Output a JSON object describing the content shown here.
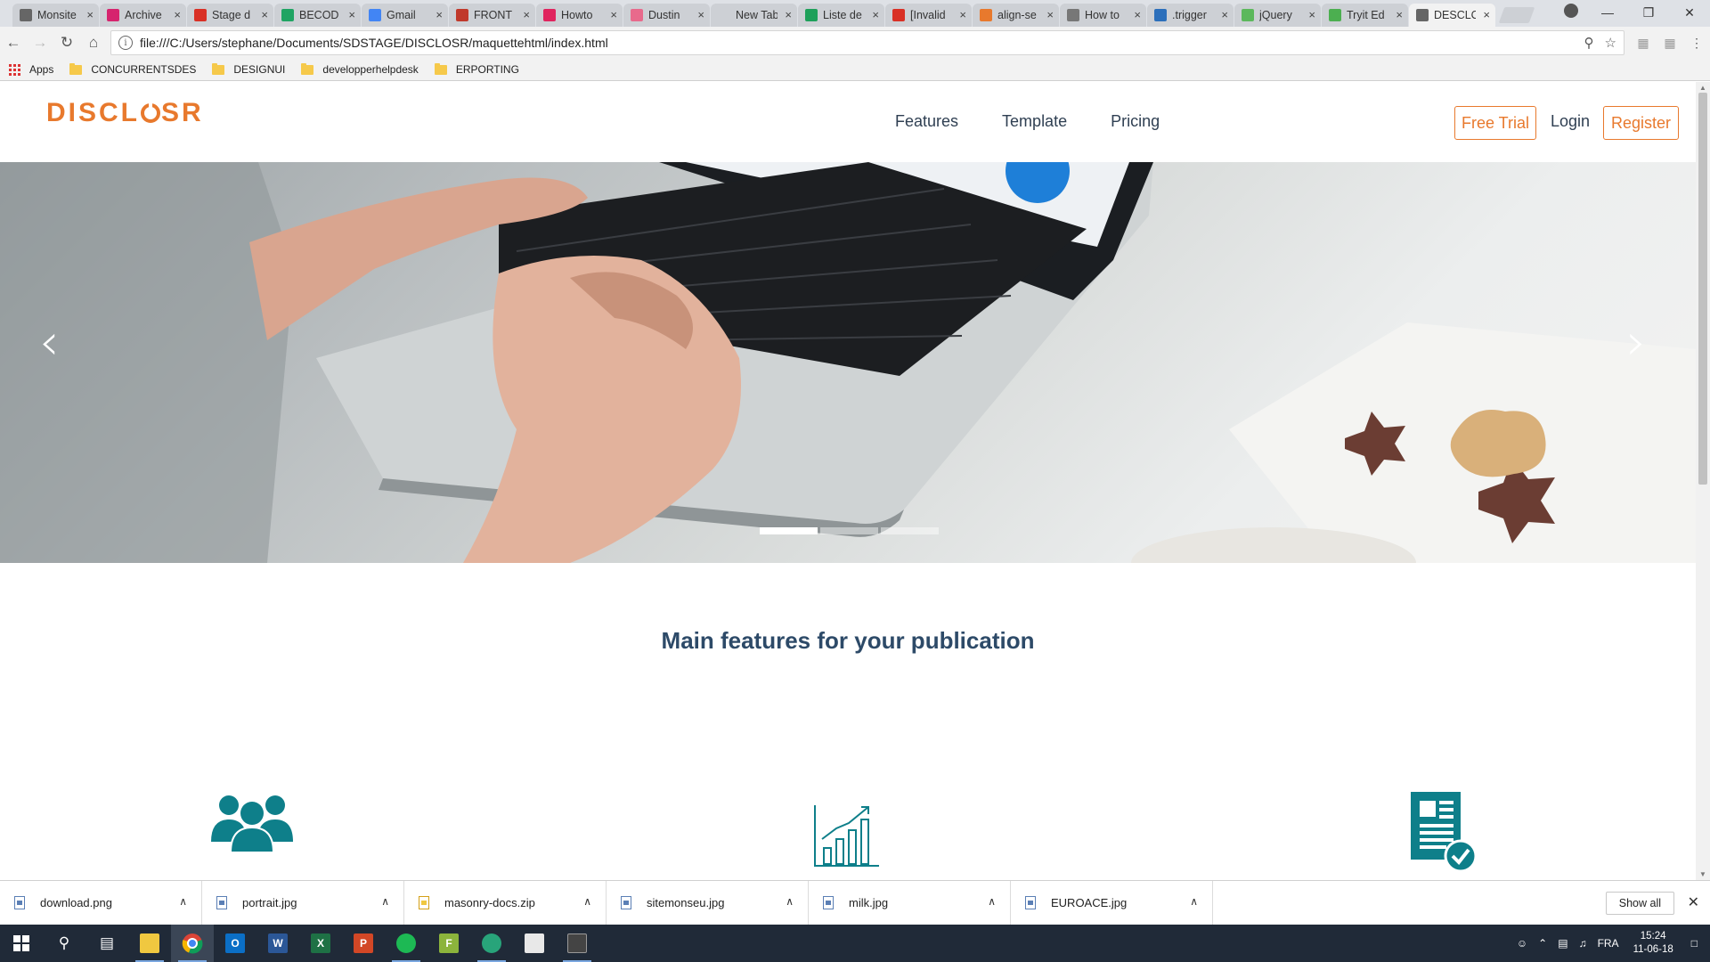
{
  "browser": {
    "tabs": [
      {
        "label": "Monsite",
        "favicon_color": "#666666",
        "active": false
      },
      {
        "label": "Archive",
        "favicon_color": "#d6246e",
        "active": false
      },
      {
        "label": "Stage d",
        "favicon_color": "#d93025",
        "active": false
      },
      {
        "label": "BECOD",
        "favicon_color": "#1fa463",
        "active": false
      },
      {
        "label": "Gmail",
        "favicon_color": "#4285f4",
        "active": false
      },
      {
        "label": "FRONT",
        "favicon_color": "#c0392b",
        "active": false
      },
      {
        "label": "Howto",
        "favicon_color": "#e0245e",
        "active": false
      },
      {
        "label": "Dustin",
        "favicon_color": "#e86a8c",
        "active": false
      },
      {
        "label": "New Tab",
        "favicon_color": "#cdd0d5",
        "active": false
      },
      {
        "label": "Liste de",
        "favicon_color": "#1ea05a",
        "active": false
      },
      {
        "label": "[Invalid",
        "favicon_color": "#d93025",
        "active": false
      },
      {
        "label": "align-se",
        "favicon_color": "#e8792d",
        "active": false
      },
      {
        "label": "How to",
        "favicon_color": "#777777",
        "active": false
      },
      {
        "label": ".trigger",
        "favicon_color": "#2c6fbb",
        "active": false
      },
      {
        "label": "jQuery",
        "favicon_color": "#5cb85c",
        "active": false
      },
      {
        "label": "Tryit Ed",
        "favicon_color": "#4caf50",
        "active": false
      },
      {
        "label": "DESCLC",
        "favicon_color": "#666666",
        "active": true
      }
    ],
    "address": "file:///C:/Users/stephane/Documents/SDSTAGE/DISCLOSR/maquettehtml/index.html",
    "bookmarks": [
      "Apps",
      "CONCURRENTSDES",
      "DESIGNUI",
      "developperhelpdesk",
      "ERPORTING"
    ]
  },
  "site": {
    "logo": "DISCL○SR",
    "logo_left": "DISCL",
    "logo_right": "SR",
    "nav": [
      "Features",
      "Template",
      "Pricing"
    ],
    "free_trial": "Free Trial",
    "login": "Login",
    "register": "Register",
    "carousel_prev": "‹",
    "carousel_next": "›",
    "carousel_active_index": 0,
    "features_title": "Main features for your publication",
    "feature_icons": [
      "users-icon",
      "growth-chart-icon",
      "verified-document-icon"
    ],
    "accent_color": "#e8792d",
    "teal_color": "#0e7f8a",
    "title_color": "#2d4a68"
  },
  "downloads": {
    "items": [
      {
        "name": "download.png",
        "type": "image"
      },
      {
        "name": "portrait.jpg",
        "type": "image"
      },
      {
        "name": "masonry-docs.zip",
        "type": "zip"
      },
      {
        "name": "sitemonseu.jpg",
        "type": "image"
      },
      {
        "name": "milk.jpg",
        "type": "image"
      },
      {
        "name": "EUROACE.jpg",
        "type": "image"
      }
    ],
    "show_all": "Show all"
  },
  "taskbar": {
    "language": "FRA",
    "time": "15:24",
    "date": "11-06-18"
  }
}
